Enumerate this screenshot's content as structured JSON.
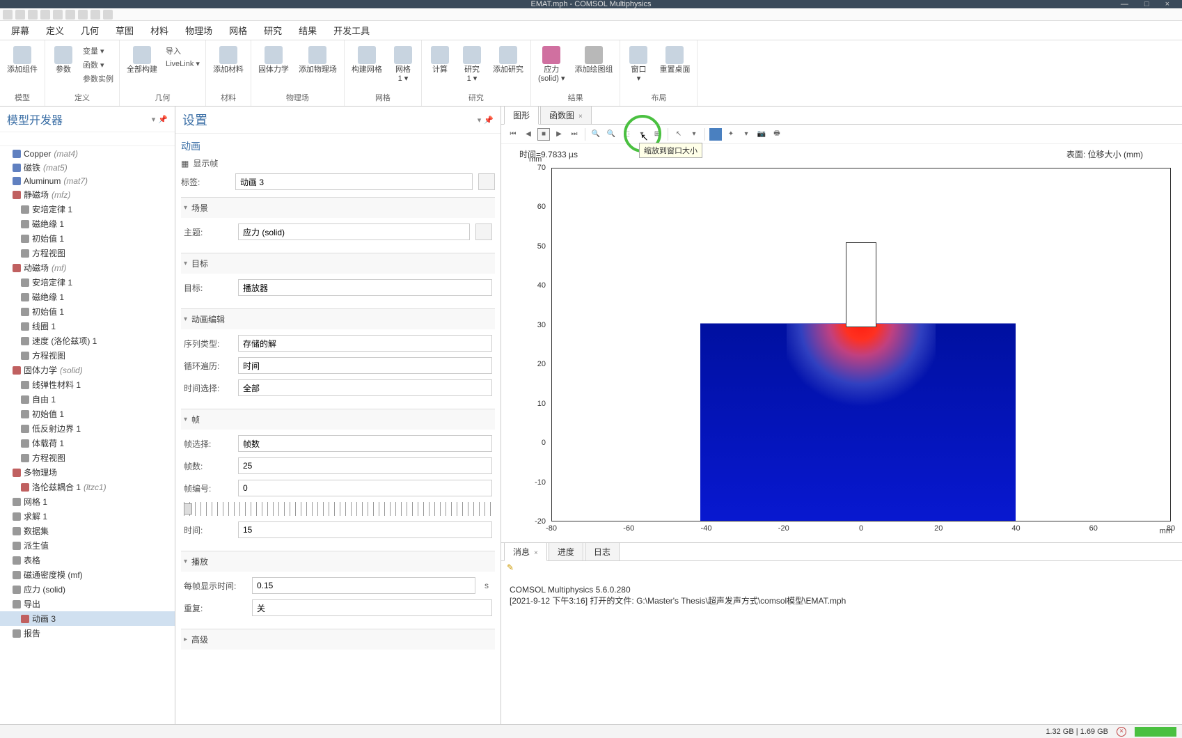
{
  "window": {
    "title": "EMAT.mph - COMSOL Multiphysics"
  },
  "menu": [
    "屏幕",
    "定义",
    "几何",
    "草图",
    "材料",
    "物理场",
    "网格",
    "研究",
    "结果",
    "开发工具"
  ],
  "ribbon": {
    "groups": [
      {
        "label": "模型",
        "items": [
          {
            "l": "添加组件",
            "sub": ""
          }
        ]
      },
      {
        "label": "定义",
        "items": [
          {
            "l": "参数"
          },
          {
            "l": "变量 ▾|函数 ▾|参数实例",
            "small": true
          }
        ]
      },
      {
        "label": "几何",
        "items": [
          {
            "l": "全部构建"
          },
          {
            "l": "导入|LiveLink ▾",
            "small": true
          }
        ]
      },
      {
        "label": "材料",
        "items": [
          {
            "l": "添加材料"
          }
        ]
      },
      {
        "label": "物理场",
        "items": [
          {
            "l": "固体力学"
          },
          {
            "l": "添加物理场"
          }
        ]
      },
      {
        "label": "网格",
        "items": [
          {
            "l": "构建网格"
          },
          {
            "l": "网格 1 ▾"
          }
        ]
      },
      {
        "label": "研究",
        "items": [
          {
            "l": "计算"
          },
          {
            "l": "研究 1 ▾"
          },
          {
            "l": "添加研究"
          }
        ]
      },
      {
        "label": "结果",
        "items": [
          {
            "l": "应力 (solid) ▾",
            "icon": "pink"
          },
          {
            "l": "添加绘图组",
            "icon": "gray"
          }
        ]
      },
      {
        "label": "布局",
        "items": [
          {
            "l": "窗口 ▾"
          },
          {
            "l": "重置桌面"
          }
        ]
      }
    ]
  },
  "tree": {
    "title": "模型开发器",
    "items": [
      {
        "t": "Copper",
        "em": "(mat4)",
        "icon": "blue"
      },
      {
        "t": "磁铁",
        "em": "(mat5)",
        "icon": "blue"
      },
      {
        "t": "Aluminum",
        "em": "(mat7)",
        "icon": "blue"
      },
      {
        "t": "静磁场",
        "em": "(mfz)",
        "icon": "red"
      },
      {
        "t": "安培定律 1",
        "sub": true,
        "icon": "gray"
      },
      {
        "t": "磁绝缘 1",
        "sub": true,
        "icon": "gray"
      },
      {
        "t": "初始值 1",
        "sub": true,
        "icon": "gray"
      },
      {
        "t": "方程视图",
        "sub": true,
        "icon": "gray"
      },
      {
        "t": "动磁场",
        "em": "(mf)",
        "icon": "red"
      },
      {
        "t": "安培定律 1",
        "sub": true,
        "icon": "gray"
      },
      {
        "t": "磁绝缘 1",
        "sub": true,
        "icon": "gray"
      },
      {
        "t": "初始值 1",
        "sub": true,
        "icon": "gray"
      },
      {
        "t": "线圈 1",
        "sub": true,
        "icon": "gray"
      },
      {
        "t": "速度 (洛伦兹项)  1",
        "sub": true,
        "icon": "gray"
      },
      {
        "t": "方程视图",
        "sub": true,
        "icon": "gray"
      },
      {
        "t": "固体力学",
        "em": "(solid)",
        "icon": "red"
      },
      {
        "t": "线弹性材料 1",
        "sub": true,
        "icon": "gray"
      },
      {
        "t": "自由 1",
        "sub": true,
        "icon": "gray"
      },
      {
        "t": "初始值 1",
        "sub": true,
        "icon": "gray"
      },
      {
        "t": "低反射边界 1",
        "sub": true,
        "icon": "gray"
      },
      {
        "t": "体载荷 1",
        "sub": true,
        "icon": "gray"
      },
      {
        "t": "方程视图",
        "sub": true,
        "icon": "gray"
      },
      {
        "t": "多物理场",
        "icon": "red"
      },
      {
        "t": "洛伦兹耦合 1",
        "em": "(ltzc1)",
        "sub": true,
        "icon": "red"
      },
      {
        "t": "网格 1",
        "icon": "gray"
      },
      {
        "t": "求解 1",
        "icon": "gray"
      },
      {
        "t": "数据集",
        "icon": "gray"
      },
      {
        "t": "派生值",
        "icon": "gray"
      },
      {
        "t": "表格",
        "icon": "gray"
      },
      {
        "t": "磁通密度模 (mf)",
        "icon": "gray"
      },
      {
        "t": "应力 (solid)",
        "icon": "gray"
      },
      {
        "t": "导出",
        "icon": "gray"
      },
      {
        "t": "动画 3",
        "sub": true,
        "icon": "red",
        "sel": true
      },
      {
        "t": "报告",
        "icon": "gray"
      }
    ]
  },
  "settings": {
    "title": "设置",
    "subtitle": "动画",
    "showframe": "显示帧",
    "tag_label": "标签:",
    "tag_value": "动画 3",
    "scene": {
      "title": "场景",
      "theme_label": "主题:",
      "theme_value": "应力 (solid)"
    },
    "target": {
      "title": "目标",
      "label": "目标:",
      "value": "播放器"
    },
    "anim": {
      "title": "动画编辑",
      "seqtype_l": "序列类型:",
      "seqtype_v": "存储的解",
      "loop_l": "循环遍历:",
      "loop_v": "时间",
      "timesel_l": "时间选择:",
      "timesel_v": "全部"
    },
    "frames": {
      "title": "帧",
      "sel_l": "帧选择:",
      "sel_v": "帧数",
      "count_l": "帧数:",
      "count_v": "25",
      "num_l": "帧编号:",
      "num_v": "0",
      "time_l": "时间:",
      "time_v": "15"
    },
    "play": {
      "title": "播放",
      "disp_l": "每帧显示时间:",
      "disp_v": "0.15",
      "unit": "s",
      "rep_l": "重复:",
      "rep_v": "关"
    },
    "advanced": {
      "title": "高级"
    }
  },
  "graphics": {
    "tabs": [
      {
        "l": "图形",
        "active": true
      },
      {
        "l": "函数图",
        "close": true
      }
    ],
    "tooltip": "缩放到窗口大小",
    "time_label": "时间=9.7833 µs",
    "surface_label": "表面: 位移大小 (mm)",
    "yunit": "mm",
    "xunit": "mm",
    "yticks": [
      70,
      60,
      50,
      40,
      30,
      20,
      10,
      0,
      -10,
      -20
    ],
    "xticks": [
      -80,
      -60,
      -40,
      -20,
      0,
      20,
      40,
      60,
      80
    ]
  },
  "messages": {
    "tabs": [
      {
        "l": "消息",
        "active": true,
        "close": true
      },
      {
        "l": "进度"
      },
      {
        "l": "日志"
      }
    ],
    "lines": [
      "COMSOL Multiphysics 5.6.0.280",
      "[2021-9-12 下午3:16] 打开的文件:   G:\\Master's Thesis\\超声发声方式\\comsol模型\\EMAT.mph"
    ]
  },
  "status": {
    "mem": "1.32 GB | 1.69 GB"
  }
}
